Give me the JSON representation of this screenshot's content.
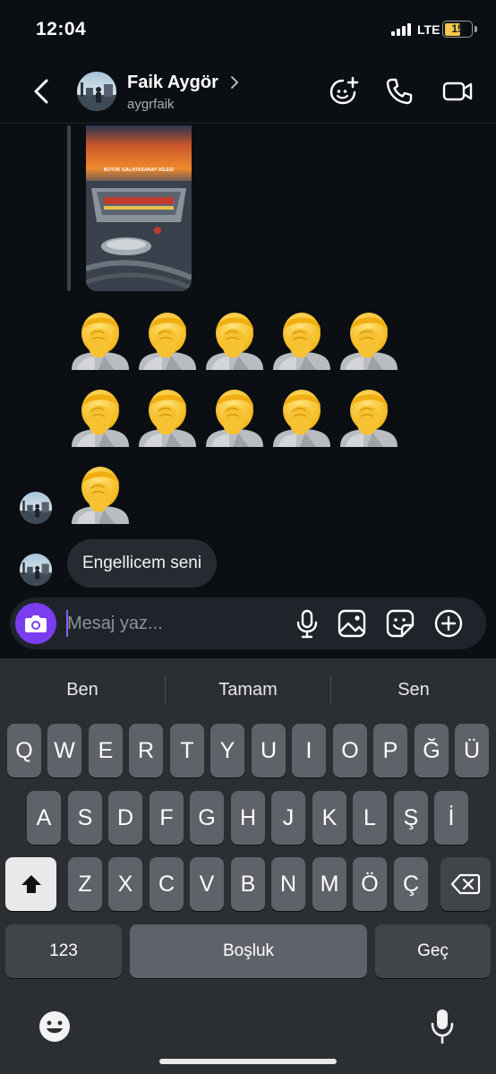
{
  "status_bar": {
    "time": "12:04",
    "network": "LTE",
    "battery": "15"
  },
  "header": {
    "name": "Faik Aygör",
    "username": "aygrfaik",
    "icons": [
      "back-icon",
      "chevron-right-icon",
      "effects-icon",
      "phone-icon",
      "video-camera-icon"
    ]
  },
  "chat": {
    "story_caption": "BÜYÜK GALATASARAY AİLESİ",
    "emoji_rows": [
      [
        "🤦",
        "🤦",
        "🤦",
        "🤦",
        "🤦"
      ],
      [
        "🤦",
        "🤦",
        "🤦",
        "🤦",
        "🤦"
      ]
    ],
    "single_emoji": "🤦",
    "message_text": "Engellicem seni"
  },
  "composer": {
    "placeholder": "Mesaj yaz...",
    "icons": [
      "camera-icon",
      "microphone-icon",
      "gallery-icon",
      "sticker-icon",
      "plus-icon"
    ]
  },
  "keyboard": {
    "suggestions": [
      "Ben",
      "Tamam",
      "Sen"
    ],
    "row1": [
      "Q",
      "W",
      "E",
      "R",
      "T",
      "Y",
      "U",
      "I",
      "O",
      "P",
      "Ğ",
      "Ü"
    ],
    "row2": [
      "A",
      "S",
      "D",
      "F",
      "G",
      "H",
      "J",
      "K",
      "L",
      "Ş",
      "İ"
    ],
    "row3": [
      "Z",
      "X",
      "C",
      "V",
      "B",
      "N",
      "M",
      "Ö",
      "Ç"
    ],
    "numbers_label": "123",
    "space_label": "Boşluk",
    "return_label": "Geç"
  },
  "colors": {
    "accent": "#7a3df0",
    "bubble": "#262b31",
    "background": "#0b0f14",
    "keyboard": "#2b2e33"
  }
}
